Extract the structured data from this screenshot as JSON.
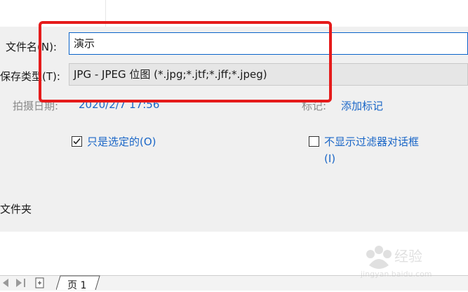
{
  "form": {
    "filename_label": "文件名(N):",
    "filename_value": "演示",
    "filetype_label": "保存类型(T):",
    "filetype_value": "JPG - JPEG 位图 (*.jpg;*.jtf;*.jff;*.jpeg)",
    "date_label": "拍摄日期:",
    "date_value": "2020/2/7 17:56",
    "tags_label": "标记:",
    "tags_value": "添加标记"
  },
  "options": {
    "selected_only": {
      "label": "只是选定的(O)",
      "checked": true
    },
    "hide_filter_dialog": {
      "label_line1": "不显示过滤器对话框",
      "label_line2": "(I)",
      "checked": false
    }
  },
  "folder": {
    "label": "文件夹"
  },
  "sheets": {
    "tab_label": "页 1"
  },
  "watermark": {
    "text_cn": "Bai度 经验",
    "text_url": "jingyan.baidu.com"
  },
  "colors": {
    "highlight": "#e51b1b",
    "link": "#1a66c7",
    "focus_border": "#0a63c9"
  }
}
